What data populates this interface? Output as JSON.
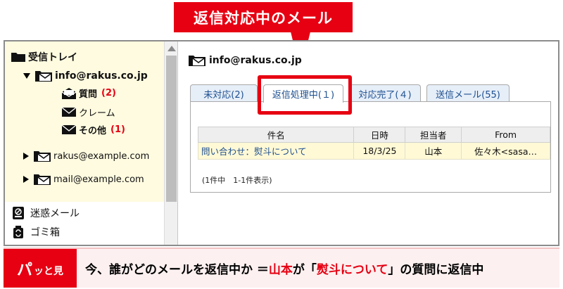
{
  "callout": {
    "text": "返信対応中のメール"
  },
  "sidebar": {
    "inbox": "受信トレイ",
    "account": "info@rakus.co.jp",
    "subfolders": [
      {
        "label": "質問",
        "count": "(2)"
      },
      {
        "label": "クレーム"
      },
      {
        "label": "その他",
        "count": "(1)"
      }
    ],
    "other_accounts": [
      "rakus@example.com",
      "mail@example.com"
    ],
    "spam": "迷惑メール",
    "trash": "ゴミ箱"
  },
  "main": {
    "account": "info@rakus.co.jp",
    "tabs": [
      {
        "label": "未対応(2)"
      },
      {
        "label": "返信処理中(１)"
      },
      {
        "label": "対応完了(４)"
      },
      {
        "label": "送信メール(55)"
      }
    ],
    "active_tab": 1,
    "table": {
      "headers": [
        "件名",
        "日時",
        "担当者",
        "From"
      ],
      "rows": [
        {
          "subject": "問い合わせ：熨斗について",
          "date": "18/3/25",
          "assignee": "山本",
          "from": "佐々木<sasa…"
        }
      ]
    },
    "count_note": "(1件中　1-1件表示)"
  },
  "banner": {
    "badge_big": "パ",
    "badge_small": "ッと見",
    "text_prefix": "今、誰がどのメールを返信中か ＝ ",
    "name": "山本",
    "text_mid": "が「",
    "subject": "熨斗について",
    "text_suffix": "」の質問に返信中"
  },
  "icons": {
    "folder": "folder-icon",
    "envelope": "envelope-icon",
    "open_envelope": "open-envelope-icon",
    "spam": "spam-icon",
    "trash": "recycle-trash-icon"
  },
  "colors": {
    "accent": "#e60012",
    "link": "#1c4e8f",
    "sidebar_bg": "#fffbe0",
    "row_bg": "#fff9d6"
  }
}
